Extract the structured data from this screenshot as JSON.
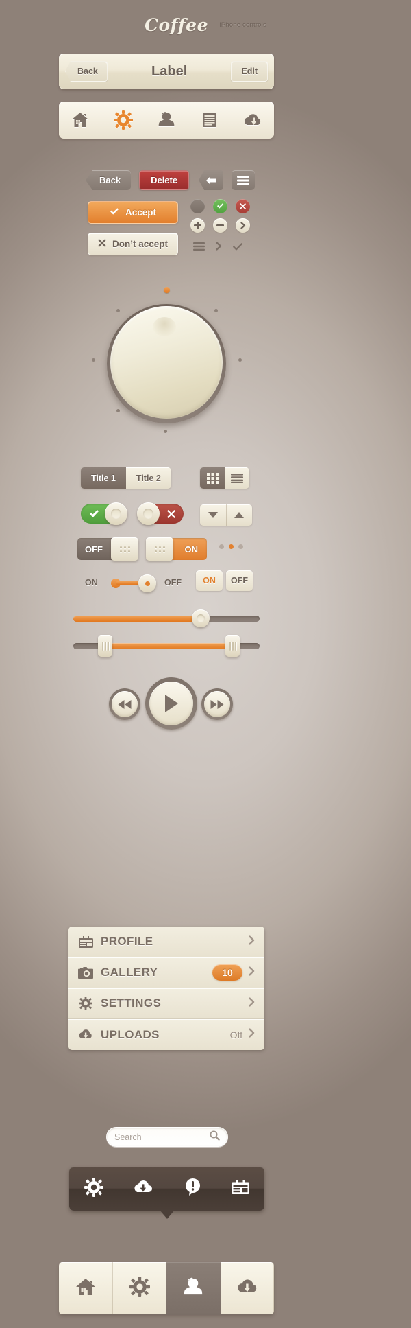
{
  "header": {
    "logo": "Coffee",
    "subtitle": "iPhone controls"
  },
  "navbar": {
    "back_label": "Back",
    "title": "Label",
    "edit_label": "Edit"
  },
  "tabbar_top": {
    "items": [
      {
        "icon": "home-icon",
        "active": false
      },
      {
        "icon": "gear-icon",
        "active": true
      },
      {
        "icon": "user-icon",
        "active": false
      },
      {
        "icon": "list-icon",
        "active": false
      },
      {
        "icon": "cloud-download-icon",
        "active": false
      }
    ]
  },
  "buttons": {
    "back_label": "Back",
    "delete_label": "Delete",
    "arrow_left_icon": "arrow-left-icon",
    "hamburger_icon": "hamburger-icon",
    "accept_label": "Accept",
    "accept_icon": "check-icon",
    "dont_accept_label": "Don’t accept",
    "dont_accept_icon": "cross-icon",
    "round_icons": [
      "blank-circle-icon",
      "check-circle-icon",
      "cross-circle-icon"
    ],
    "stepper_icons": [
      "plus-circle-icon",
      "minus-circle-icon",
      "chevron-right-circle-icon"
    ],
    "plain_icons": [
      "hamburger-icon",
      "chevron-right-icon",
      "check-icon"
    ]
  },
  "knob": {
    "indicator_icon": "knob-indicator",
    "tick_count": 6
  },
  "segmented": {
    "title1": "Title 1",
    "title2": "Title 2",
    "grid_icon": "grid-view-icon",
    "list_icon": "list-view-icon"
  },
  "toggles": {
    "on_icon": "check-icon",
    "off_icon": "cross-icon",
    "down_icon": "triangle-down-icon",
    "up_icon": "triangle-up-icon"
  },
  "switches": {
    "off_label": "OFF",
    "on_label": "ON",
    "pill_on": "ON",
    "pill_off": "OFF",
    "mini_left_label": "ON",
    "mini_right_label": "OFF"
  },
  "page_dots": {
    "count": 3,
    "active_index": 1,
    "active_color": "#e2812f",
    "inactive_color": "#b6aaa1"
  },
  "sliders": [
    {
      "name": "volume-slider",
      "value_percent": 68,
      "handle": "round"
    },
    {
      "name": "range-slider",
      "low_percent": 17,
      "high_percent": 85,
      "handle": "rect"
    }
  ],
  "media": {
    "prev_icon": "rewind-icon",
    "play_icon": "play-icon",
    "next_icon": "fast-forward-icon"
  },
  "list": {
    "rows": [
      {
        "icon": "profile-card-icon",
        "label": "PROFILE",
        "badge": null,
        "value": null,
        "chevron": "chevron-right-icon"
      },
      {
        "icon": "camera-icon",
        "label": "GALLERY",
        "badge": "10",
        "value": null,
        "chevron": "chevron-right-icon"
      },
      {
        "icon": "gear-icon",
        "label": "SETTINGS",
        "badge": null,
        "value": null,
        "chevron": "chevron-right-icon"
      },
      {
        "icon": "cloud-download-icon",
        "label": "UPLOADS",
        "badge": null,
        "value": "Off",
        "chevron": "chevron-right-icon"
      }
    ]
  },
  "search": {
    "placeholder": "Search",
    "icon": "search-icon"
  },
  "popover": {
    "items": [
      {
        "icon": "gear-icon"
      },
      {
        "icon": "cloud-download-icon"
      },
      {
        "icon": "alert-bubble-icon"
      },
      {
        "icon": "calendar-icon"
      }
    ]
  },
  "tabbar_bottom": {
    "items": [
      {
        "icon": "home-icon",
        "active": false
      },
      {
        "icon": "gear-icon",
        "active": false
      },
      {
        "icon": "user-icon",
        "active": true
      },
      {
        "icon": "cloud-download-icon",
        "active": false
      }
    ]
  },
  "colors": {
    "accent_orange": "#e2812f",
    "danger_red": "#a83d36",
    "success_green": "#50a23f",
    "brown": "#7a6e64",
    "cream": "#f2eee0"
  }
}
